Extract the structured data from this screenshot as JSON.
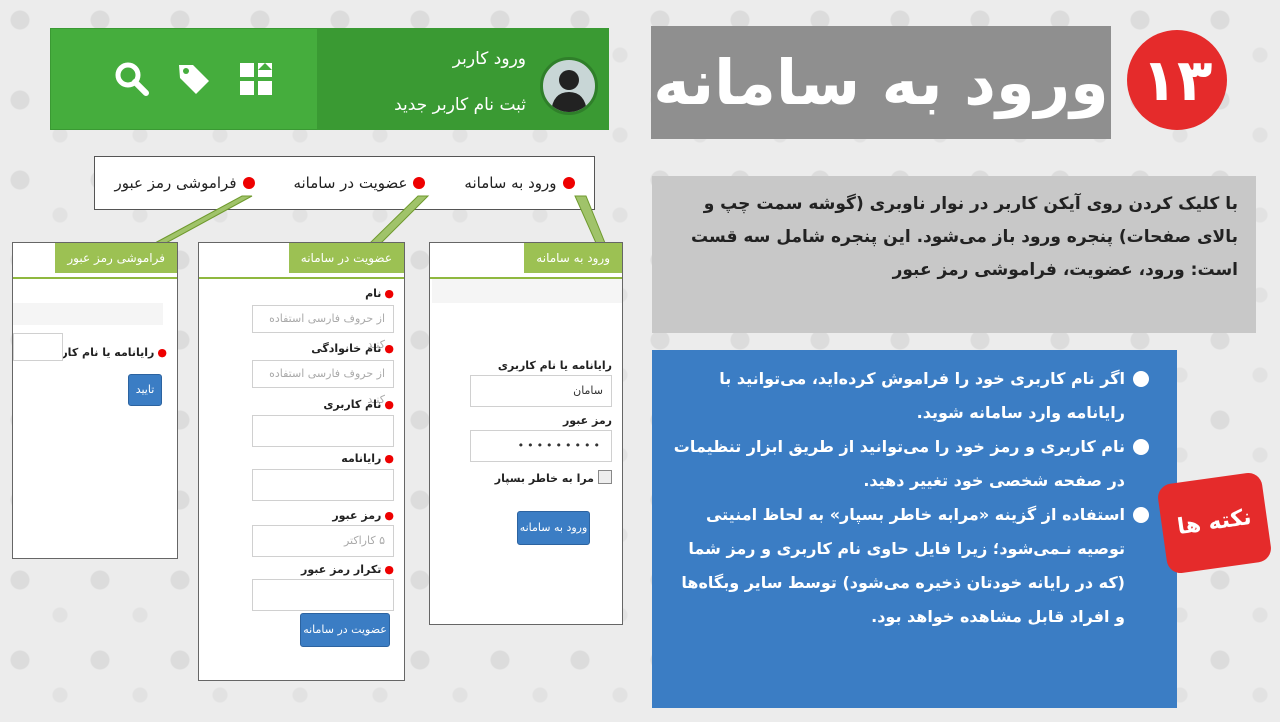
{
  "title": "ورود به سامانه",
  "step_number": "۱۳",
  "topbar": {
    "icons": [
      "search-icon",
      "tag-icon",
      "grid-icon"
    ],
    "login_label": "ورود کاربر",
    "register_label": "ثبت نام کاربر جدید"
  },
  "menu": {
    "items": [
      "ورود به سامانه",
      "عضویت در سامانه",
      "فراموشی رمز عبور"
    ]
  },
  "login_panel": {
    "tab": "ورود به سامانه",
    "email_label": "رایانامه یا نام کاربری",
    "email_value": "سامان",
    "password_label": "رمز عبور",
    "password_value": "•••••••••",
    "remember_label": "مرا به خاطر بسپار",
    "submit_label": "ورود به سامانه"
  },
  "register_panel": {
    "tab": "عضویت در سامانه",
    "name_label": "نام",
    "name_placeholder": "از حروف فارسی استفاده کنید",
    "family_label": "نام خانوادگی",
    "family_placeholder": "از حروف فارسی استفاده کنید",
    "username_label": "نام کاربری",
    "email_label": "رایانامه",
    "password_label": "رمز عبور",
    "password_placeholder": "۵ کاراکتر",
    "repeat_label": "تکرار رمز عبور",
    "submit_label": "عضویت در سامانه"
  },
  "forgot_panel": {
    "tab": "فراموشی رمز عبور",
    "email_label": "رایانامه یا نام کاربری",
    "submit_label": "تایید"
  },
  "info_text": "با کلیک کردن روی آیکن کاربر در نوار ناوبری (گوشه سمت چپ و بالای صفحات) پنجره ورود باز می‌شود. این پنجره شامل سه قست است: ورود، عضویت، فراموشی رمز عبور",
  "notes": {
    "tag": "نکته ها",
    "items": [
      "اگر نام کاربری خود را فراموش کرده‌اید، می‌توانید با رایانامه وارد سامانه شوید.",
      "نام کاربری و رمز خود را می‌توانید از طریق ابزار تنظیمات در صفحه شخصی خود تغییر دهید.",
      "استفاده از گزینه «مرابه خاطر بسپار» به لحاظ امنیتی توصیه نـمی‌شود؛ زیرا فایل حاوی نام کاربری و رمز شما (که در رایانه خودتان ذخیره می‌شود) توسط سایر وبگاه‌ها و افراد قابل مشاهده خواهد بود."
    ]
  },
  "colors": {
    "green": "#45ad3d",
    "red": "#e52b2b",
    "blue": "#3b7dc4",
    "panel_green": "#9cc153"
  }
}
